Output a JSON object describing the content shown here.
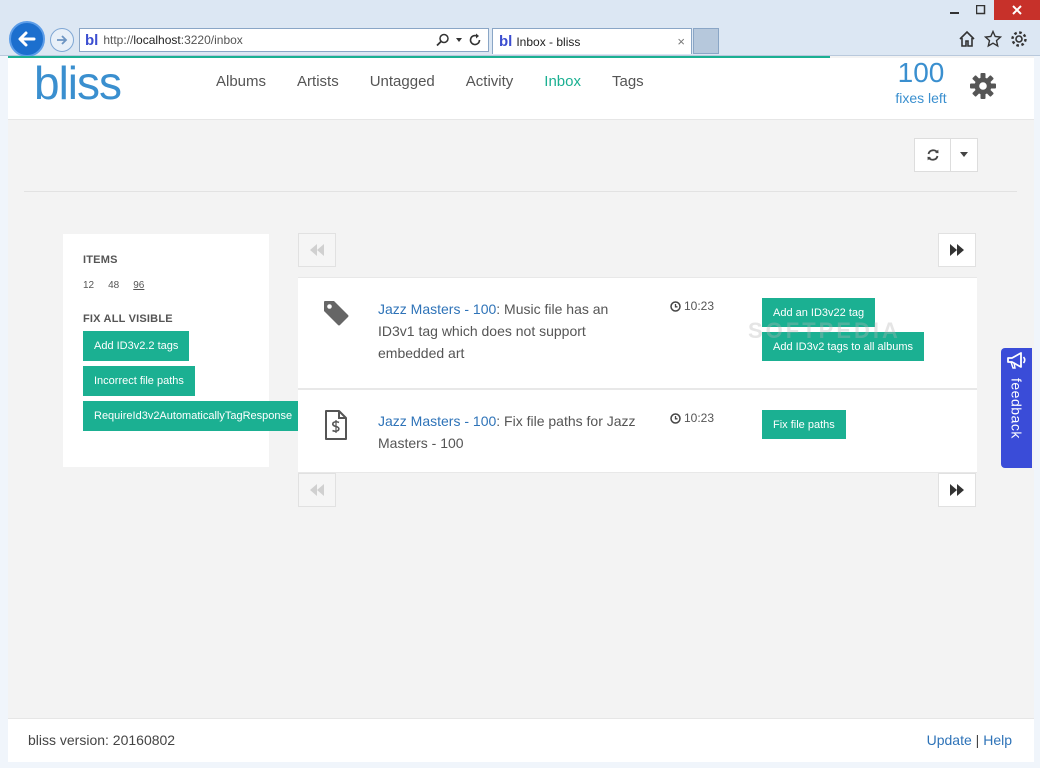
{
  "browser": {
    "address_favicon": "bl",
    "url_prefix": "http://",
    "url_host": "localhost",
    "url_rest": ":3220/inbox",
    "tab_favicon": "bl",
    "tab_title": "Inbox - bliss",
    "tab_close": "×"
  },
  "header": {
    "logo": "bliss",
    "nav": [
      {
        "label": "Albums"
      },
      {
        "label": "Artists"
      },
      {
        "label": "Untagged"
      },
      {
        "label": "Activity"
      },
      {
        "label": "Inbox",
        "active": true
      },
      {
        "label": "Tags"
      }
    ],
    "fixes_count": "100",
    "fixes_label": "fixes left"
  },
  "sidebar": {
    "items_heading": "ITEMS",
    "counts": [
      "12",
      "48",
      "96"
    ],
    "selected_count": "96",
    "fixall_heading": "FIX ALL VISIBLE",
    "buttons": [
      {
        "label": "Add ID3v2.2 tags"
      },
      {
        "label": "Incorrect file paths"
      },
      {
        "label": "RequireId3v2AutomaticallyTagResponse"
      }
    ]
  },
  "inbox": {
    "items": [
      {
        "icon": "tag-icon",
        "link": "Jazz Masters - 100",
        "message": ": Music file has an ID3v1 tag which does not support embedded art",
        "time": "10:23",
        "actions": [
          "Add an ID3v22 tag",
          "Add ID3v2 tags to all albums"
        ]
      },
      {
        "icon": "file-path-icon",
        "link": "Jazz Masters - 100",
        "message": ": Fix file paths for Jazz Masters - 100",
        "time": "10:23",
        "actions": [
          "Fix file paths"
        ]
      }
    ]
  },
  "feedback": {
    "label": "feedback"
  },
  "footer": {
    "version": "bliss version: 20160802",
    "update": "Update",
    "separator": " | ",
    "help": "Help"
  },
  "watermark": "SOFTPEDIA",
  "colors": {
    "accent": "#1bb092",
    "brand_blue": "#3a8fcf",
    "feedback_blue": "#3a4cd8"
  }
}
